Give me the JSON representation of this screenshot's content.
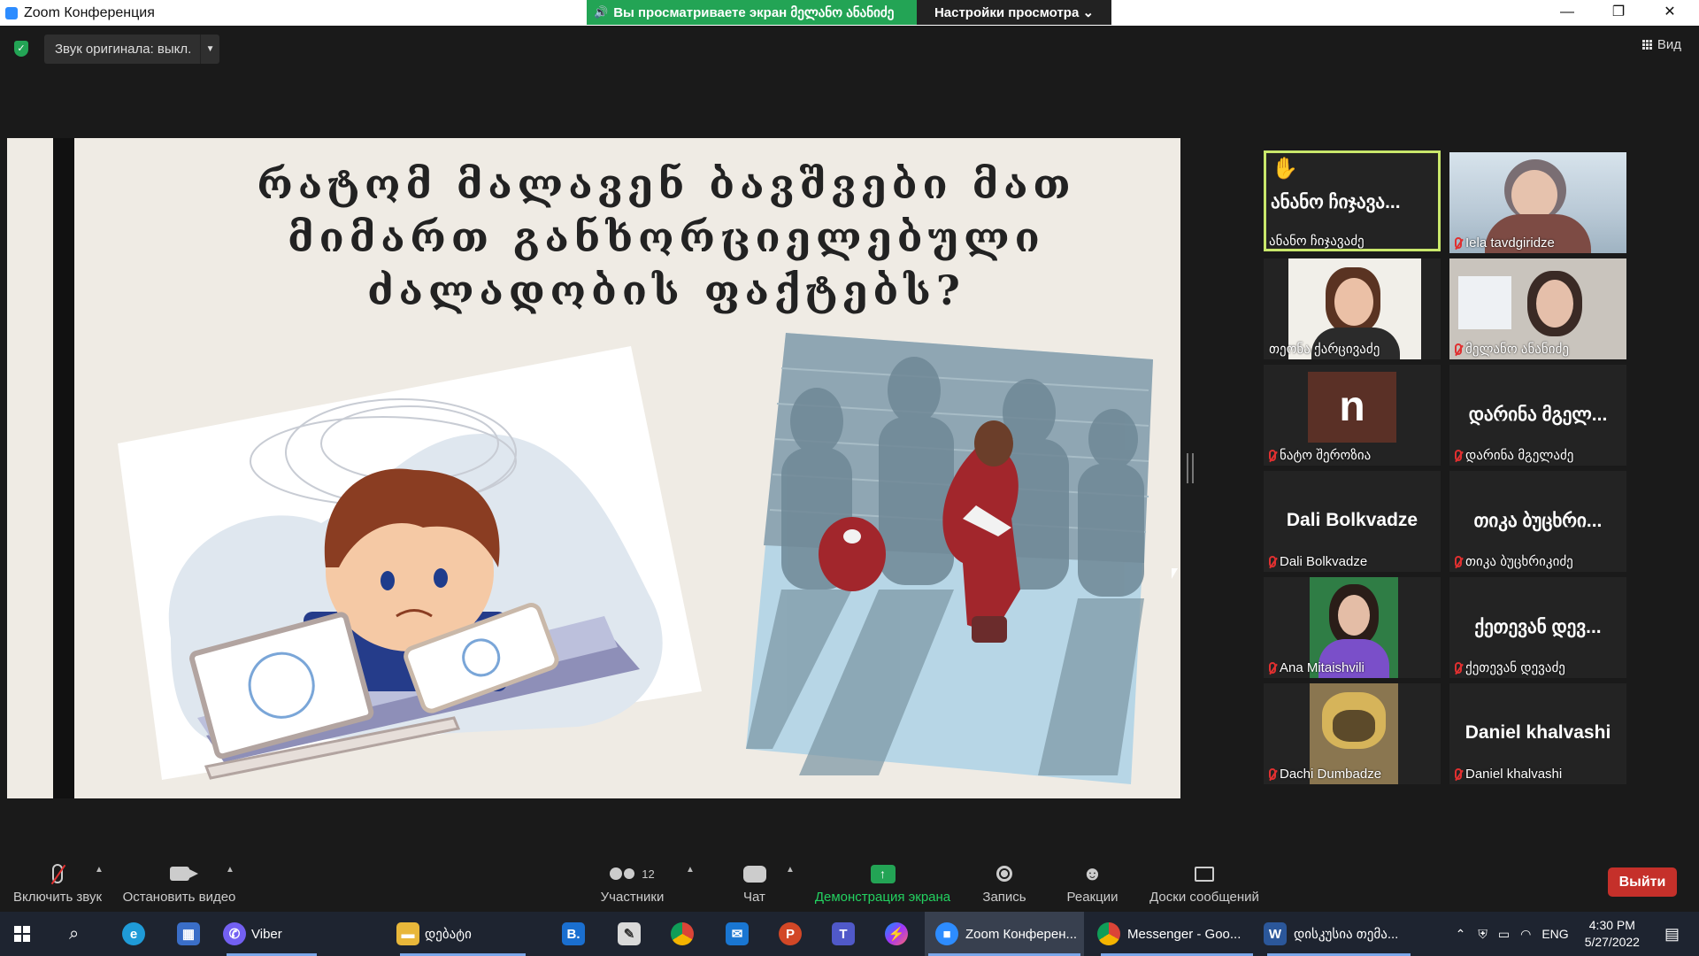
{
  "window": {
    "title": "Zoom Конференция",
    "share_banner": "Вы просматриваете экран მელანო ანანიძე",
    "view_settings": "Настройки просмотра ⌄",
    "controls": [
      "—",
      "❐",
      "✕"
    ]
  },
  "meeting_top": {
    "original_sound": "Звук оригинала: выкл.",
    "view_label": "Вид"
  },
  "slide": {
    "title_lines": [
      "რატომ მალავენ ბავშვები მათ",
      "მიმართ განხორციელებული",
      "ძალადობის ფაქტებს?"
    ]
  },
  "participants": [
    {
      "display": "ანანო ჩიჯავა...",
      "label": "ანანო ჩიჯავაძე",
      "hand_raised": true,
      "active_speaker": true,
      "muted": false,
      "video": false
    },
    {
      "display": "",
      "label": "Iela tavdgiridze",
      "muted": true,
      "video": true
    },
    {
      "display": "",
      "label": "თეონა ქარცივაძე",
      "muted": false,
      "video": true
    },
    {
      "display": "",
      "label": "მელანო ანანიძე",
      "muted": true,
      "video": true
    },
    {
      "display": "",
      "label": "ნატო შეროზია",
      "avatar_letter": "n",
      "muted": true,
      "video": false
    },
    {
      "display": "დარინა მგელ...",
      "label": "დარინა მგელაძე",
      "muted": true,
      "video": false
    },
    {
      "display": "Dali Bolkvadze",
      "label": "Dali Bolkvadze",
      "muted": true,
      "video": false
    },
    {
      "display": "თიკა ბუცხრი...",
      "label": "თიკა ბუცხრიკიძე",
      "muted": true,
      "video": false
    },
    {
      "display": "",
      "label": "Ana Mitaishvili",
      "muted": true,
      "video": true
    },
    {
      "display": "ქეთევან დევ...",
      "label": "ქეთევან დევაძე",
      "muted": true,
      "video": false
    },
    {
      "display": "",
      "label": "Dachi Dumbadze",
      "muted": true,
      "video": true
    },
    {
      "display": "Daniel khalvashi",
      "label": "Daniel khalvashi",
      "muted": true,
      "video": false
    }
  ],
  "toolbar": {
    "unmute": "Включить звук",
    "stop_video": "Остановить видео",
    "participants": "Участники",
    "participants_count": "12",
    "chat": "Чат",
    "share_screen": "Демонстрация экрана",
    "record": "Запись",
    "reactions": "Реакции",
    "whiteboards": "Доски сообщений",
    "leave": "Выйти"
  },
  "taskbar": {
    "apps": [
      "Viber",
      "დებატი",
      "Zoom Конферен...",
      "Messenger - Goo...",
      "დისკუსია თემა..."
    ],
    "lang": "ENG",
    "time": "4:30 PM",
    "date": "5/27/2022"
  },
  "colors": {
    "share_green": "#23a455",
    "leave_red": "#c5302a",
    "active_speaker": "#c9e76b",
    "muted_red": "#e03030"
  }
}
